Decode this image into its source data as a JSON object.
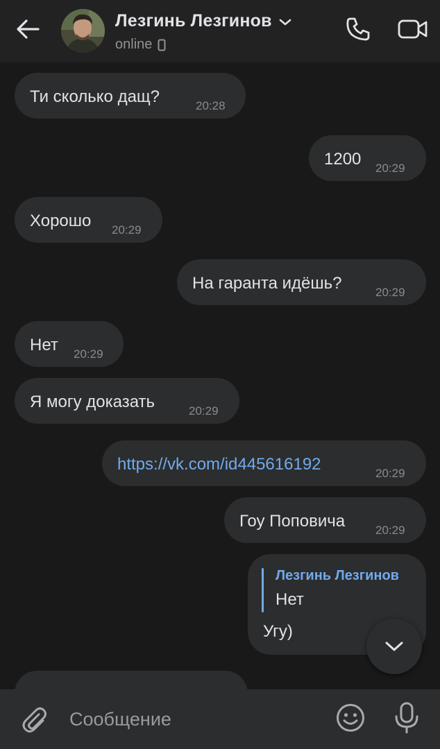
{
  "header": {
    "contact_name": "Лезгинь Лезгинов",
    "status": "online",
    "icons": {
      "back": "arrow-left-icon",
      "dropdown": "chevron-down-icon",
      "device": "mobile-device-icon",
      "call": "phone-icon",
      "video": "video-camera-icon"
    }
  },
  "messages": [
    {
      "direction": "incoming",
      "text": "Ти сколько дащ?",
      "time": "20:28"
    },
    {
      "direction": "outgoing",
      "text": "1200",
      "time": "20:29"
    },
    {
      "direction": "incoming",
      "text": "Хорошо",
      "time": "20:29"
    },
    {
      "direction": "outgoing",
      "text": "На гаранта идёшь?",
      "time": "20:29"
    },
    {
      "direction": "incoming",
      "text": "Нет",
      "time": "20:29"
    },
    {
      "direction": "incoming",
      "text": "Я могу доказать",
      "time": "20:29"
    },
    {
      "direction": "outgoing",
      "text": "https://vk.com/id445616192",
      "time": "20:29",
      "is_link": true
    },
    {
      "direction": "outgoing",
      "text": "Гоу Поповича",
      "time": "20:29"
    },
    {
      "direction": "outgoing",
      "reply_author": "Лезгинь Лезгинов",
      "reply_text": "Нет",
      "text": "Угу)"
    }
  ],
  "composer": {
    "placeholder": "Сообщение",
    "icons": {
      "attach": "paperclip-icon",
      "emoji": "smiley-icon",
      "mic": "microphone-icon"
    }
  },
  "scroll_down": {
    "icon": "chevron-down-icon"
  },
  "colors": {
    "background": "#19191a",
    "header": "#222223",
    "bubble": "#2c2d2e",
    "accent": "#71aaeb",
    "text": "#e1e3e6",
    "time": "#8b8b8b"
  }
}
